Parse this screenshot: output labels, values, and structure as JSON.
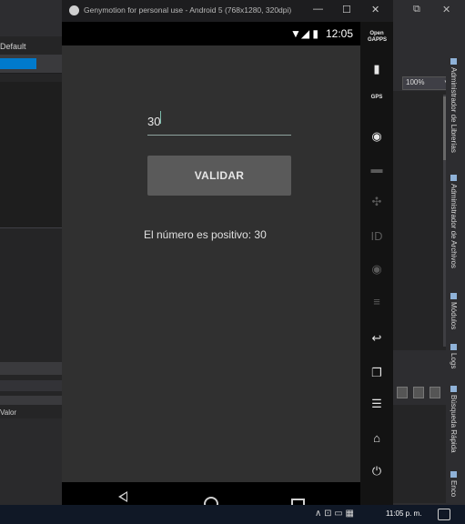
{
  "ide": {
    "left_panel": {
      "default_label": "Default",
      "valor_label": "Valor"
    },
    "right_panel": {
      "zoom_value": "100%",
      "vertical_tabs": [
        "Administrador de Librerías",
        "Administrador de Archivos",
        "Módulos",
        "Logs",
        "Búsqueda Rápida",
        "Enco"
      ]
    }
  },
  "emulator": {
    "window_title": "Genymotion for personal use - Android 5 (768x1280, 320dpi)",
    "title_controls": {
      "minimize": "—",
      "maximize": "☐",
      "close": "✕"
    },
    "status_bar": {
      "icons": "▼◢ ▮",
      "time": "12:05"
    },
    "app": {
      "input_value": "30",
      "validate_label": "VALIDAR",
      "result_text": "El número es positivo: 30"
    },
    "toolbar_icons": [
      {
        "name": "open-gapps-icon",
        "glyph": "Open GAPPS",
        "dim": false
      },
      {
        "name": "battery-icon",
        "glyph": "▮",
        "dim": false
      },
      {
        "name": "gps-icon",
        "glyph": "GPS",
        "dim": false
      },
      {
        "name": "webcam-icon",
        "glyph": "◉",
        "dim": false
      },
      {
        "name": "camera-icon",
        "glyph": "▬",
        "dim": true
      },
      {
        "name": "remote-control-icon",
        "glyph": "✣",
        "dim": true
      },
      {
        "name": "id-icon",
        "glyph": "ID",
        "dim": true
      },
      {
        "name": "disk-io-icon",
        "glyph": "◉",
        "dim": true
      },
      {
        "name": "network-icon",
        "glyph": "≡",
        "dim": true
      },
      {
        "name": "back-icon",
        "glyph": "↩",
        "dim": false
      },
      {
        "name": "recent-apps-icon",
        "glyph": "❐",
        "dim": false
      },
      {
        "name": "menu-icon",
        "glyph": "☰",
        "dim": false
      },
      {
        "name": "home-icon",
        "glyph": "⌂",
        "dim": false
      },
      {
        "name": "power-icon",
        "glyph": "⏻",
        "dim": false
      }
    ]
  },
  "taskbar": {
    "tray_icons": "∧ ⊡ ▭ ▦",
    "time": "11:05 p. m."
  }
}
